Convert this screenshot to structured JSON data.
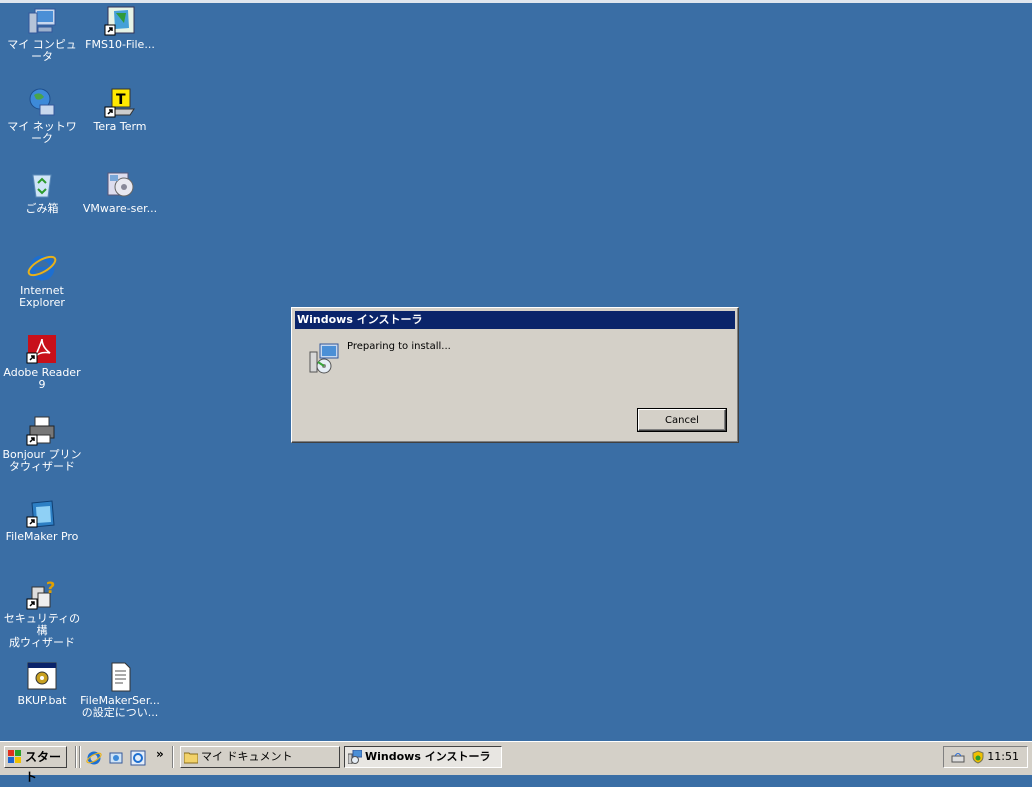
{
  "desktop": {
    "icons": [
      {
        "label": "マイ コンピュータ",
        "icon": "my-computer-icon"
      },
      {
        "label": "FMS10-File...",
        "icon": "filemaker-server-shortcut-icon"
      },
      {
        "label": "マイ ネットワーク",
        "icon": "my-network-icon"
      },
      {
        "label": "Tera Term",
        "icon": "tera-term-icon"
      },
      {
        "label": "ごみ箱",
        "icon": "recycle-bin-icon"
      },
      {
        "label": "VMware-ser...",
        "icon": "vmware-server-icon"
      },
      {
        "label": "Internet\nExplorer",
        "icon": "internet-explorer-icon"
      },
      {
        "label": "Adobe Reader\n9",
        "icon": "adobe-reader-icon"
      },
      {
        "label": "Bonjour プリン\nタウィザード",
        "icon": "printer-icon"
      },
      {
        "label": "FileMaker Pro",
        "icon": "filemaker-pro-icon"
      },
      {
        "label": "セキュリティの構\n成ウィザード",
        "icon": "security-wizard-icon"
      },
      {
        "label": "BKUP.bat",
        "icon": "batch-file-icon"
      },
      {
        "label": "FileMakerSer...\nの設定につい...",
        "icon": "text-document-icon"
      }
    ]
  },
  "dialog": {
    "title": "Windows インストーラ",
    "message": "Preparing to install...",
    "cancel_label": "Cancel"
  },
  "taskbar": {
    "start_label": "スタート",
    "overflow_chevron": "»",
    "tasks": [
      {
        "label": "マイ ドキュメント",
        "icon": "folder-icon"
      },
      {
        "label": "Windows インストーラ",
        "icon": "installer-icon"
      }
    ],
    "clock": "11:51"
  },
  "colors": {
    "desktop": "#3a6ea5",
    "titlebar": "#0a246a",
    "face": "#d4d0c8"
  }
}
